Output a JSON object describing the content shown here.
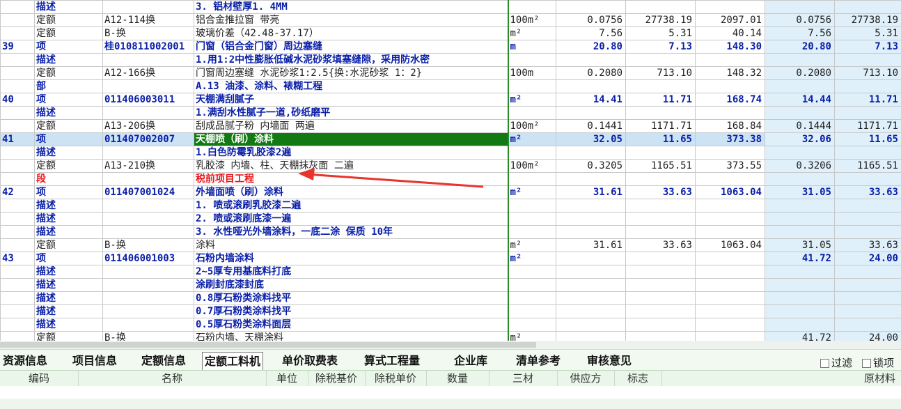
{
  "rows": [
    {
      "type": "desc",
      "c0": "",
      "c1": "描述",
      "c2": "",
      "c3": "3. 铝材壁厚1. 4MM",
      "c4": "",
      "c5": "",
      "c6": "",
      "c7": "",
      "c8": "",
      "c9": ""
    },
    {
      "type": "quota",
      "c0": "",
      "c1": "定额",
      "c2": "A12-114换",
      "c3": "铝合金推拉窗 带亮",
      "c4": "100m²",
      "c5": "0.0756",
      "c6": "27738.19",
      "c7": "2097.01",
      "c8": "0.0756",
      "c9": "27738.19"
    },
    {
      "type": "quota",
      "c0": "",
      "c1": "定额",
      "c2": "B-换",
      "c3": "玻璃价差（42.48-37.17）",
      "c4": "m²",
      "c5": "7.56",
      "c6": "5.31",
      "c7": "40.14",
      "c8": "7.56",
      "c9": "5.31"
    },
    {
      "type": "item",
      "c0": "39",
      "c1": "项",
      "c2": "桂010811002001",
      "c3": "门窗（铝合金门窗）周边塞缝",
      "c4": "m",
      "c5": "20.80",
      "c6": "7.13",
      "c7": "148.30",
      "c8": "20.80",
      "c9": "7.13"
    },
    {
      "type": "desc",
      "c0": "",
      "c1": "描述",
      "c2": "",
      "c3": "1.用1:2中性膨胀低碱水泥砂浆填塞缝隙，采用防水密",
      "c4": "",
      "c5": "",
      "c6": "",
      "c7": "",
      "c8": "",
      "c9": ""
    },
    {
      "type": "quota",
      "c0": "",
      "c1": "定额",
      "c2": "A12-166换",
      "c3": "门窗周边塞缝 水泥砂浆1:2.5{换:水泥砂浆 1：2}",
      "c4": "100m",
      "c5": "0.2080",
      "c6": "713.10",
      "c7": "148.32",
      "c8": "0.2080",
      "c9": "713.10"
    },
    {
      "type": "part",
      "c0": "",
      "c1": "部",
      "c2": "",
      "c3": "A.13 油漆、涂料、裱糊工程",
      "c4": "",
      "c5": "",
      "c6": "",
      "c7": "",
      "c8": "",
      "c9": ""
    },
    {
      "type": "item",
      "c0": "40",
      "c1": "项",
      "c2": "011406003011",
      "c3": "天棚满刮腻子",
      "c4": "m²",
      "c5": "14.41",
      "c6": "11.71",
      "c7": "168.74",
      "c8": "14.44",
      "c9": "11.71"
    },
    {
      "type": "desc",
      "c0": "",
      "c1": "描述",
      "c2": "",
      "c3": "1.满刮水性腻子一道,砂纸磨平",
      "c4": "",
      "c5": "",
      "c6": "",
      "c7": "",
      "c8": "",
      "c9": ""
    },
    {
      "type": "quota",
      "c0": "",
      "c1": "定额",
      "c2": "A13-206换",
      "c3": "刮成品腻子粉 内墙面 两遍",
      "c4": "100m²",
      "c5": "0.1441",
      "c6": "1171.71",
      "c7": "168.84",
      "c8": "0.1444",
      "c9": "1171.71"
    },
    {
      "type": "item sel",
      "c0": "41",
      "c1": "项",
      "c2": "011407002007",
      "c3": "天棚喷（刷）涂料",
      "c4": "m²",
      "c5": "32.05",
      "c6": "11.65",
      "c7": "373.38",
      "c8": "32.06",
      "c9": "11.65"
    },
    {
      "type": "desc",
      "c0": "",
      "c1": "描述",
      "c2": "",
      "c3": "1.白色防霉乳胶漆2遍",
      "c4": "",
      "c5": "",
      "c6": "",
      "c7": "",
      "c8": "",
      "c9": ""
    },
    {
      "type": "quota",
      "c0": "",
      "c1": "定额",
      "c2": "A13-210换",
      "c3": "乳胶漆 内墙、柱、天棚抹灰面 二遍",
      "c4": "100m²",
      "c5": "0.3205",
      "c6": "1165.51",
      "c7": "373.55",
      "c8": "0.3206",
      "c9": "1165.51"
    },
    {
      "type": "seg",
      "c0": "",
      "c1": "段",
      "c2": "",
      "c3": "税前项目工程",
      "c4": "",
      "c5": "",
      "c6": "",
      "c7": "",
      "c8": "",
      "c9": ""
    },
    {
      "type": "item",
      "c0": "42",
      "c1": "项",
      "c2": "011407001024",
      "c3": "外墙面喷（刷）涂料",
      "c4": "m²",
      "c5": "31.61",
      "c6": "33.63",
      "c7": "1063.04",
      "c8": "31.05",
      "c9": "33.63"
    },
    {
      "type": "desc",
      "c0": "",
      "c1": "描述",
      "c2": "",
      "c3": "1. 喷或滚刷乳胶漆二遍",
      "c4": "",
      "c5": "",
      "c6": "",
      "c7": "",
      "c8": "",
      "c9": ""
    },
    {
      "type": "desc",
      "c0": "",
      "c1": "描述",
      "c2": "",
      "c3": "2. 喷或滚刷底漆一遍",
      "c4": "",
      "c5": "",
      "c6": "",
      "c7": "",
      "c8": "",
      "c9": ""
    },
    {
      "type": "desc",
      "c0": "",
      "c1": "描述",
      "c2": "",
      "c3": "3. 水性哑光外墙涂料，一底二涂 保质 10年",
      "c4": "",
      "c5": "",
      "c6": "",
      "c7": "",
      "c8": "",
      "c9": ""
    },
    {
      "type": "quota",
      "c0": "",
      "c1": "定额",
      "c2": "B-换",
      "c3": "涂料",
      "c4": "m²",
      "c5": "31.61",
      "c6": "33.63",
      "c7": "1063.04",
      "c8": "31.05",
      "c9": "33.63"
    },
    {
      "type": "item",
      "c0": "43",
      "c1": "项",
      "c2": "011406001003",
      "c3": "石粉内墙涂料",
      "c4": "m²",
      "c5": "",
      "c6": "",
      "c7": "",
      "c8": "41.72",
      "c9": "24.00"
    },
    {
      "type": "desc",
      "c0": "",
      "c1": "描述",
      "c2": "",
      "c3": "2~5厚专用基底料打底",
      "c4": "",
      "c5": "",
      "c6": "",
      "c7": "",
      "c8": "",
      "c9": ""
    },
    {
      "type": "desc",
      "c0": "",
      "c1": "描述",
      "c2": "",
      "c3": "涂刷封底漆封底",
      "c4": "",
      "c5": "",
      "c6": "",
      "c7": "",
      "c8": "",
      "c9": ""
    },
    {
      "type": "desc",
      "c0": "",
      "c1": "描述",
      "c2": "",
      "c3": "0.8厚石粉类涂料找平",
      "c4": "",
      "c5": "",
      "c6": "",
      "c7": "",
      "c8": "",
      "c9": ""
    },
    {
      "type": "desc",
      "c0": "",
      "c1": "描述",
      "c2": "",
      "c3": "0.7厚石粉类涂料找平",
      "c4": "",
      "c5": "",
      "c6": "",
      "c7": "",
      "c8": "",
      "c9": ""
    },
    {
      "type": "desc",
      "c0": "",
      "c1": "描述",
      "c2": "",
      "c3": "0.5厚石粉类涂料面层",
      "c4": "",
      "c5": "",
      "c6": "",
      "c7": "",
      "c8": "",
      "c9": ""
    },
    {
      "type": "quota",
      "c0": "",
      "c1": "定额",
      "c2": "B-换",
      "c3": "石粉内墙、天棚涂料",
      "c4": "m²",
      "c5": "",
      "c6": "",
      "c7": "",
      "c8": "41.72",
      "c9": "24.00"
    }
  ],
  "tabs": [
    "资源信息",
    "项目信息",
    "定额信息",
    "定额工料机",
    "单价取费表",
    "算式工程量",
    "企业库",
    "清单参考",
    "审核意见"
  ],
  "active_tab": "定额工料机",
  "checkboxes": [
    "过滤",
    "锁项"
  ],
  "sub_headers": [
    "编码",
    "名称",
    "单位",
    "除税基价",
    "除税单价",
    "数量",
    "三材",
    "供应方",
    "标志",
    "原材料"
  ],
  "colors": {
    "item_text": "#0a1fa8",
    "segment_text": "#e8181b",
    "selected_cell_bg": "#127a12",
    "highlight_column_bg": "#dff0fb",
    "annotation_arrow": "#e8342a"
  }
}
